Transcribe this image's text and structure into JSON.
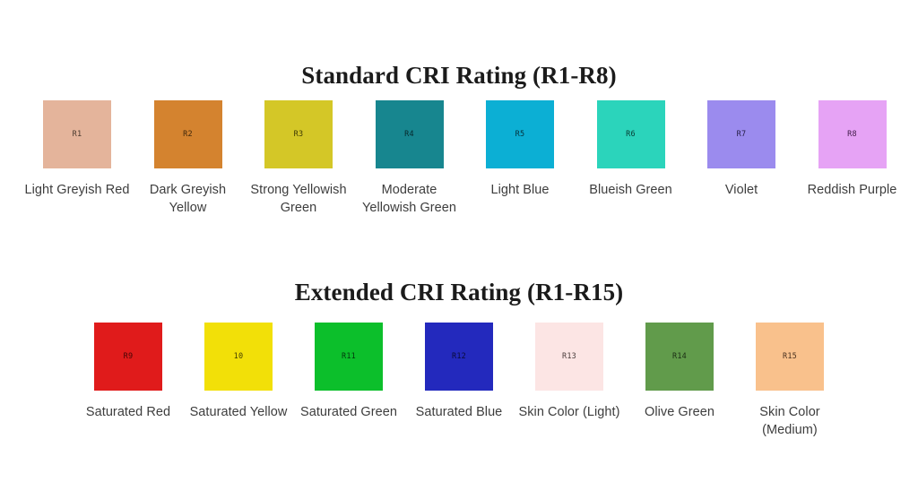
{
  "standard": {
    "title": "Standard CRI Rating (R1-R8)",
    "swatches": [
      {
        "code": "R1",
        "label": "Light Greyish Red",
        "color": "#e4b49b",
        "code_color": "#4a3a2e"
      },
      {
        "code": "R2",
        "label": "Dark Greyish Yellow",
        "color": "#d4832f",
        "code_color": "#40280c"
      },
      {
        "code": "R3",
        "label": "Strong Yellowish Green",
        "color": "#d4c727",
        "code_color": "#3c3805"
      },
      {
        "code": "R4",
        "label": "Moderate Yellowish Green",
        "color": "#17868f",
        "code_color": "#06282b"
      },
      {
        "code": "R5",
        "label": "Light Blue",
        "color": "#0cafd4",
        "code_color": "#04323d"
      },
      {
        "code": "R6",
        "label": "Blueish Green",
        "color": "#2bd4bb",
        "code_color": "#073b33"
      },
      {
        "code": "R7",
        "label": "Violet",
        "color": "#9b8bee",
        "code_color": "#251d46"
      },
      {
        "code": "R8",
        "label": "Reddish Purple",
        "color": "#e6a3f5",
        "code_color": "#3f1b47"
      }
    ]
  },
  "extended": {
    "title": "Extended CRI Rating (R1-R15)",
    "swatches": [
      {
        "code": "R9",
        "label": "Saturated Red",
        "color": "#e01b1b",
        "code_color": "#450505"
      },
      {
        "code": "10",
        "label": "Saturated Yellow",
        "color": "#f2e008",
        "code_color": "#443f02"
      },
      {
        "code": "R11",
        "label": "Saturated Green",
        "color": "#0cbf2b",
        "code_color": "#03380c"
      },
      {
        "code": "R12",
        "label": "Saturated Blue",
        "color": "#2329bd",
        "code_color": "#0a0b38"
      },
      {
        "code": "R13",
        "label": "Skin Color (Light)",
        "color": "#fce5e4",
        "code_color": "#4a3c3b"
      },
      {
        "code": "R14",
        "label": "Olive Green",
        "color": "#619b4b",
        "code_color": "#1b2e14"
      },
      {
        "code": "R15",
        "label": "Skin Color (Medium)",
        "color": "#f9c18c",
        "code_color": "#4a3220"
      }
    ]
  }
}
